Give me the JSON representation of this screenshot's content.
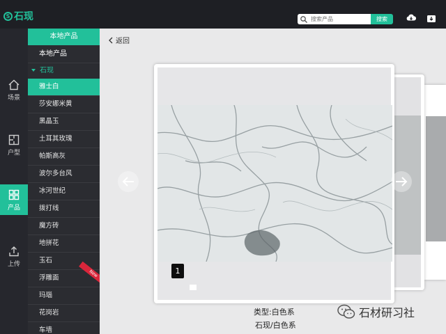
{
  "app": {
    "brand": "石现",
    "brand_mark": "S"
  },
  "search": {
    "placeholder": "搜索产品",
    "button": "搜索"
  },
  "icons": {
    "download": "download-cloud-icon",
    "downloads": "download-box-icon",
    "search": "search-icon"
  },
  "colors": {
    "accent": "#22c09a",
    "topbar": "#1e1f24",
    "sidebar": "#26272d",
    "category_panel": "#2b2c31",
    "new_badge": "#d9263b"
  },
  "leftnav": [
    {
      "label": "场景",
      "icon": "home-icon"
    },
    {
      "label": "户型",
      "icon": "floorplan-icon"
    },
    {
      "label": "产品",
      "icon": "grid-icon",
      "active": true
    },
    {
      "label": "上传",
      "icon": "upload-icon"
    }
  ],
  "categories": {
    "header": "本地产品",
    "local_label": "本地产品",
    "group_label": "石现",
    "items": [
      {
        "label": "雅士白",
        "active": true
      },
      {
        "label": "莎安娜米黄"
      },
      {
        "label": "黑晶玉"
      },
      {
        "label": "土耳其玫瑰"
      },
      {
        "label": "帕斯高灰"
      },
      {
        "label": "波尔多台风"
      },
      {
        "label": "冰河世纪"
      },
      {
        "label": "拨打线"
      },
      {
        "label": "魔方砖"
      },
      {
        "label": "地拼花"
      },
      {
        "label": "玉石"
      },
      {
        "label": "浮雕面",
        "badge": "New"
      },
      {
        "label": "玛瑙"
      },
      {
        "label": "花岗岩"
      },
      {
        "label": "车墙"
      }
    ]
  },
  "main": {
    "back_label": "返回",
    "page_number": "1",
    "type_line": "类型:白色系",
    "category_line": "石现/白色系"
  },
  "watermark": {
    "text": "石材研习社"
  }
}
